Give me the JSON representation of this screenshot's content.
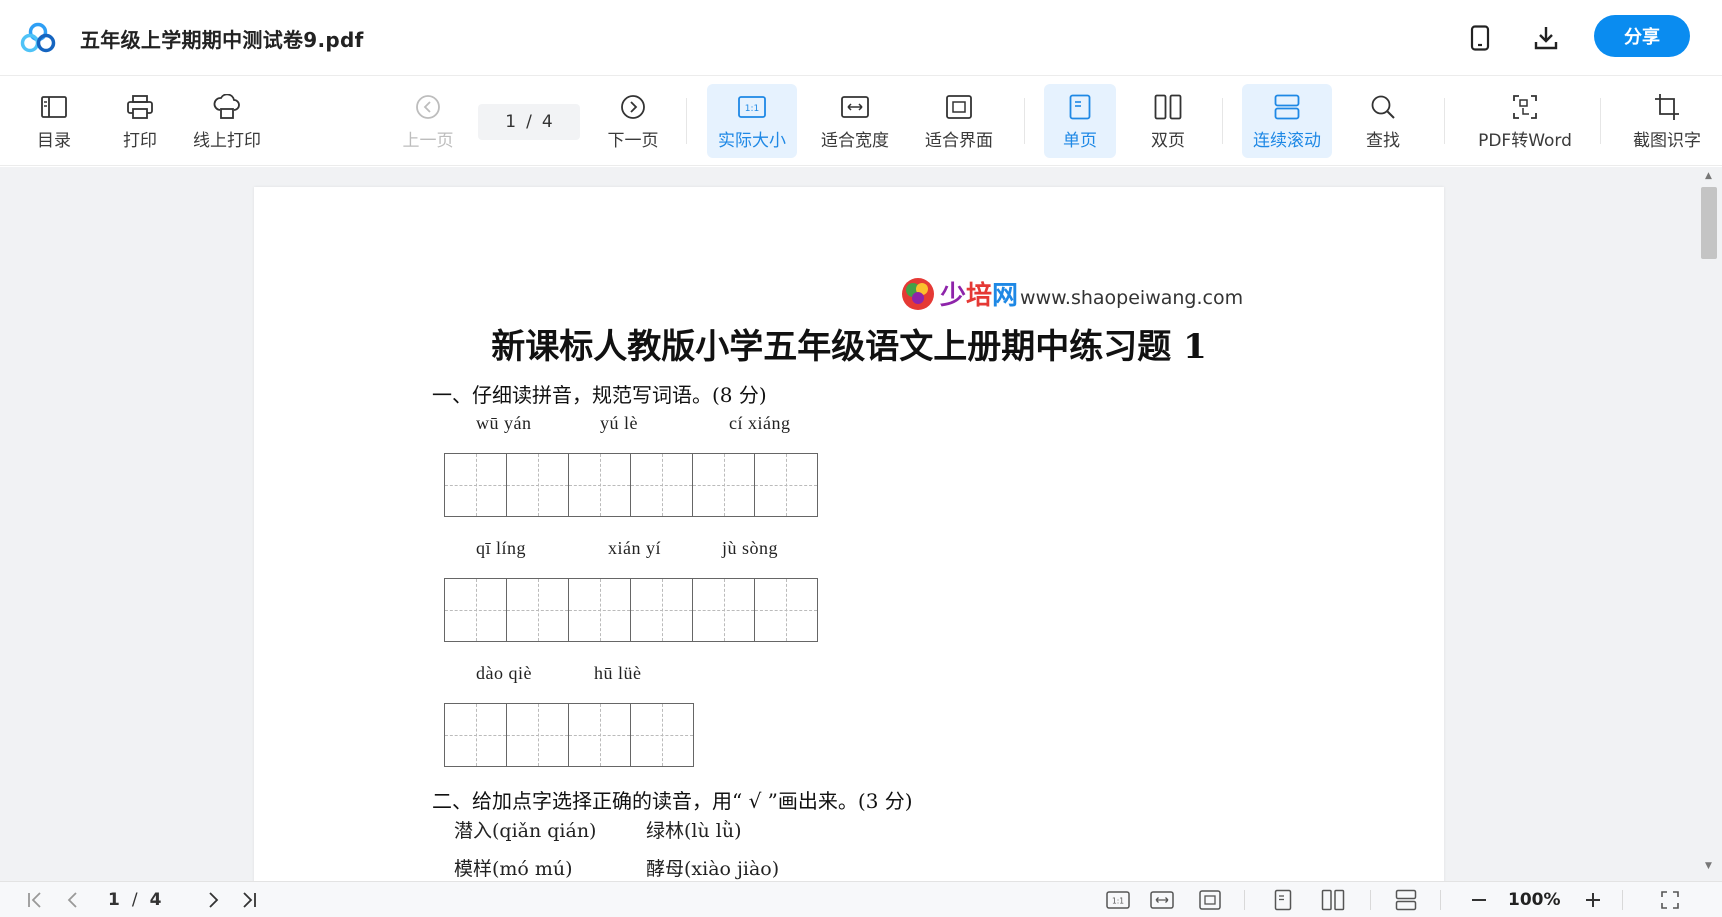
{
  "header": {
    "file_title": "五年级上学期期中测试卷9.pdf",
    "share_label": "分享",
    "icons": [
      "app-logo",
      "phone-icon",
      "download-icon"
    ]
  },
  "toolbar": {
    "toc": "目录",
    "print": "打印",
    "online_print": "线上打印",
    "prev_page": "上一页",
    "page_current": "1",
    "page_sep": "/",
    "page_total": "4",
    "next_page": "下一页",
    "actual_size": "实际大小",
    "fit_width": "适合宽度",
    "fit_screen": "适合界面",
    "single_page": "单页",
    "double_page": "双页",
    "continuous_scroll": "连续滚动",
    "find": "查找",
    "pdf_to_word": "PDF转Word",
    "screenshot_ocr": "截图识字",
    "accent_color": "#1e88e5"
  },
  "document": {
    "watermark_text": "少培网",
    "watermark_site": "www.shaopeiwang.com",
    "title": "新课标人教版小学五年级语文上册期中练习题 1",
    "q1": "一、仔细读拼音，规范写词语。(8 分)",
    "py_row1": [
      "wū  yán",
      "yú  lè",
      "cí  xiáng"
    ],
    "py_row2": [
      "qī  líng",
      "xián  yí",
      "jù  sòng"
    ],
    "py_row3": [
      "dào  qiè",
      "hū  lüè"
    ],
    "q2": "二、给加点字选择正确的读音，用“ √ ”画出来。(3 分)",
    "opt1": "潜入(qiǎn  qián)",
    "opt2": "绿林(lù  lǜ)",
    "opt3": "模样(mó  mú)",
    "opt4": "酵母(xiào  jiào)"
  },
  "statusbar": {
    "page_current": "1",
    "page_sep": "/",
    "page_total": "4",
    "zoom": "100%"
  }
}
